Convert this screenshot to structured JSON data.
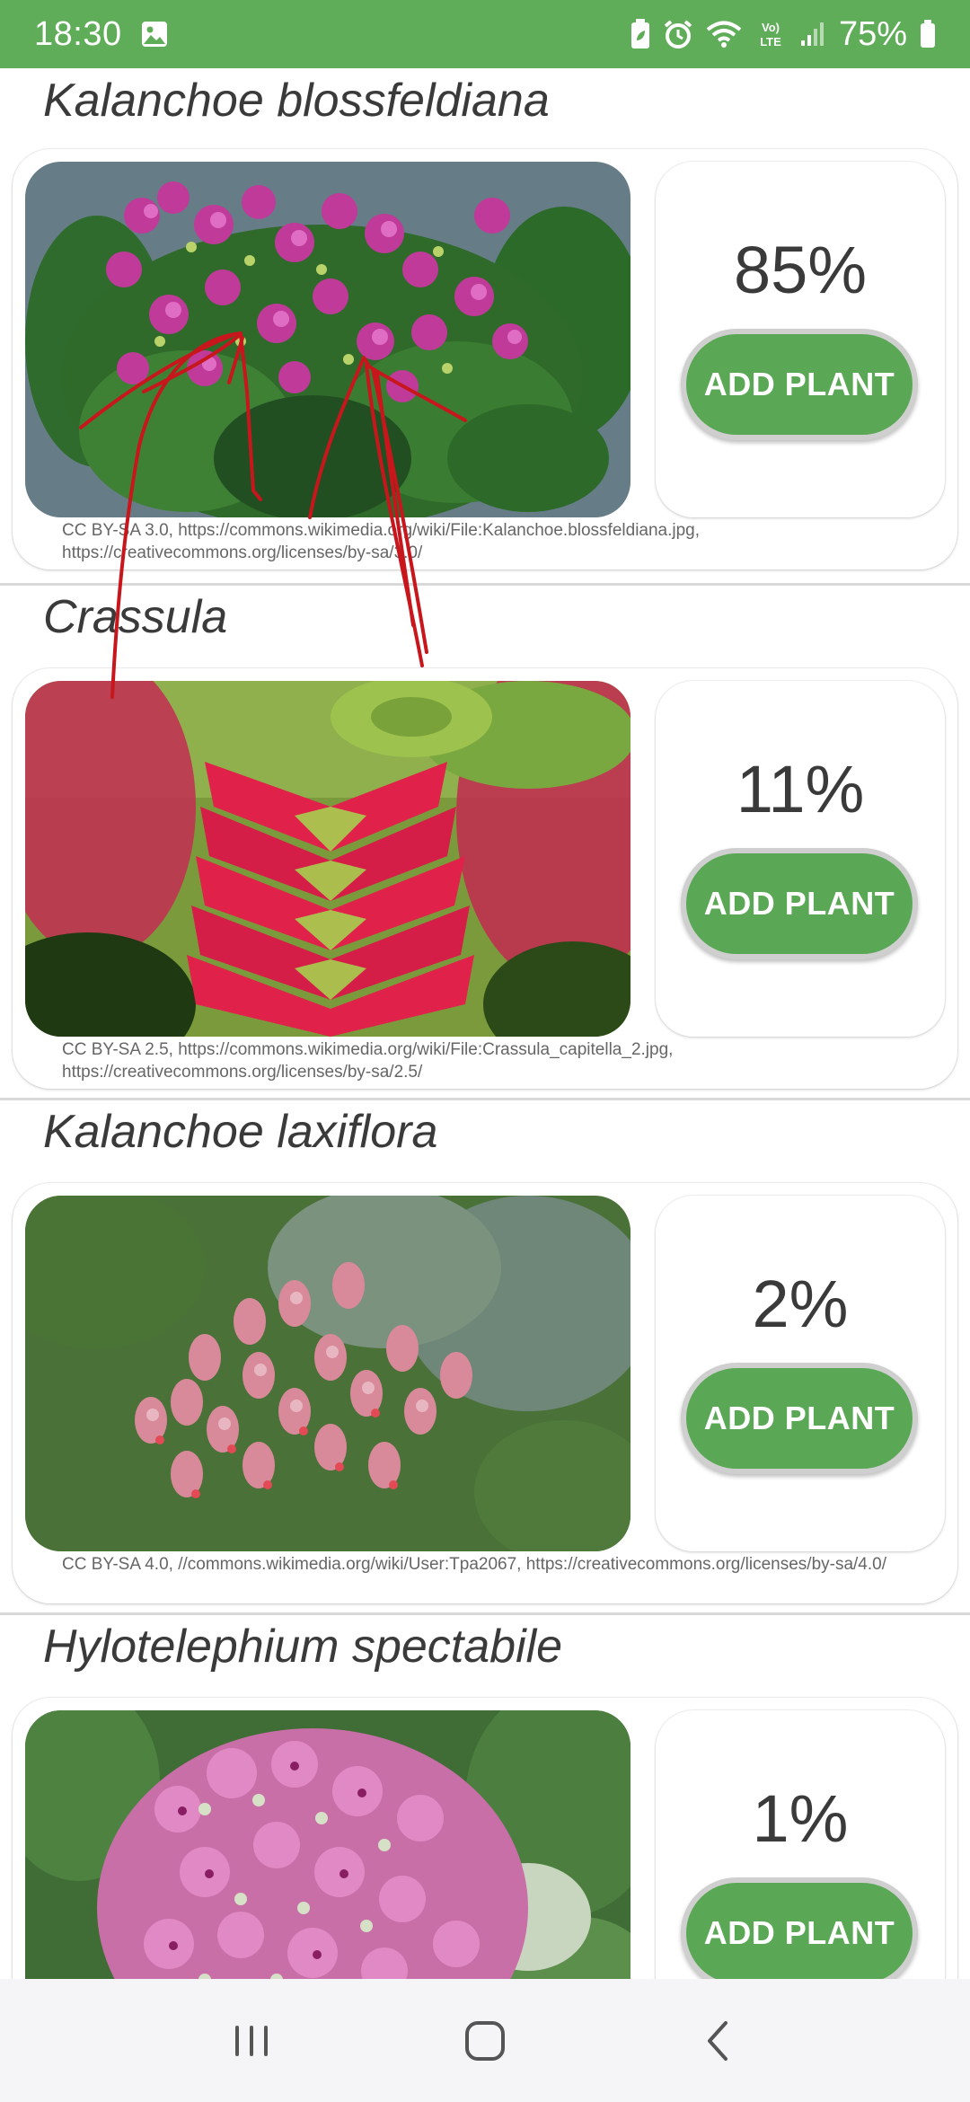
{
  "status_bar": {
    "time": "18:30",
    "battery": "75%",
    "network_label": "Vo) LTE",
    "icons": [
      "image-icon",
      "battery-saver-icon",
      "alarm-icon",
      "wifi-icon",
      "volte-icon",
      "signal-icon",
      "battery-icon"
    ]
  },
  "theme": {
    "primary": "#5fad59",
    "button": "#5aa856",
    "annotation": "#c8161d"
  },
  "plants": [
    {
      "name": "Kalanchoe blossfeldiana",
      "score": "85%",
      "button_label": "ADD PLANT",
      "attribution": "CC BY-SA 3.0, https://commons.wikimedia.org/wiki/File:Kalanchoe.blossfeldiana.jpg, https://creativecommons.org/licenses/by-sa/3.0/"
    },
    {
      "name": "Crassula",
      "score": "11%",
      "button_label": "ADD PLANT",
      "attribution": "CC BY-SA 2.5, https://commons.wikimedia.org/wiki/File:Crassula_capitella_2.jpg, https://creativecommons.org/licenses/by-sa/2.5/"
    },
    {
      "name": "Kalanchoe laxiflora",
      "score": "2%",
      "button_label": "ADD PLANT",
      "attribution": "CC BY-SA 4.0, //commons.wikimedia.org/wiki/User:Tpa2067, https://creativecommons.org/licenses/by-sa/4.0/"
    },
    {
      "name": "Hylotelephium spectabile",
      "score": "1%",
      "button_label": "ADD PLANT",
      "attribution": ""
    }
  ],
  "nav_bar": {
    "icons": [
      "recent-apps-icon",
      "home-icon",
      "back-icon"
    ]
  }
}
